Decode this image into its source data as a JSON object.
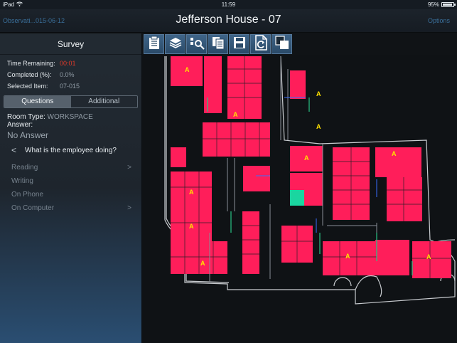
{
  "status_bar": {
    "carrier": "iPad",
    "time": "11:59",
    "battery": "95%",
    "battery_level": 0.95
  },
  "nav": {
    "back_label": "Observati...015-06-12",
    "title": "Jefferson House - 07",
    "options_label": "Options"
  },
  "sidebar": {
    "title": "Survey",
    "stats": [
      {
        "label": "Time Remaining:",
        "value": "00:01"
      },
      {
        "label": "Completed (%):",
        "value": "0.0%"
      },
      {
        "label": "Selected Item:",
        "value": "07-015"
      }
    ],
    "tabs": [
      {
        "label": "Questions"
      },
      {
        "label": "Additional"
      }
    ],
    "room_type_label": "Room Type:",
    "room_type_value": "WORKSPACE",
    "answer_label": "Answer:",
    "answer_value": "No Answer",
    "back_glyph": "<",
    "question": "What is the employee doing?",
    "options": [
      {
        "label": "Reading",
        "has_submenu": true
      },
      {
        "label": "Writing",
        "has_submenu": false
      },
      {
        "label": "On Phone",
        "has_submenu": false
      },
      {
        "label": "On Computer",
        "has_submenu": true
      }
    ]
  },
  "toolbar": {
    "buttons": [
      {
        "icon": "clipboard-icon"
      },
      {
        "icon": "layers-icon"
      },
      {
        "icon": "key-icon"
      },
      {
        "icon": "copy-icon"
      },
      {
        "icon": "save-icon"
      },
      {
        "icon": "refresh-document-icon"
      },
      {
        "icon": "overlap-squares-icon"
      }
    ]
  },
  "floorplan": {
    "room_marker": "A",
    "colors": {
      "room": "#ff1e5a",
      "selected": "#1ad6a0",
      "walls": "#c9ccd0",
      "marker": "#ffe100",
      "background": "#0f1215"
    }
  }
}
